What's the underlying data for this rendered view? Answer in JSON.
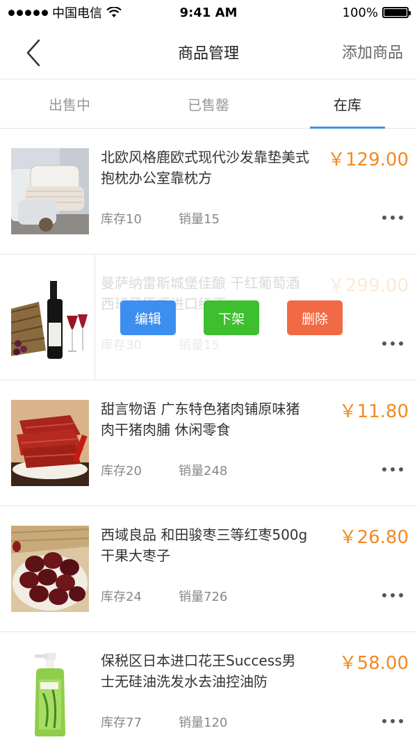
{
  "status_bar": {
    "carrier": "中国电信",
    "time": "9:41 AM",
    "battery": "100%"
  },
  "nav": {
    "title": "商品管理",
    "action": "添加商品",
    "back_icon": "chevron-left-icon"
  },
  "tabs": [
    {
      "label": "出售中",
      "active": false
    },
    {
      "label": "已售罄",
      "active": false
    },
    {
      "label": "在库",
      "active": true
    }
  ],
  "colors": {
    "accent": "#3f8fe6",
    "price": "#f08a24",
    "edit": "#3c8ff0",
    "offshelf": "#3dbf2f",
    "delete": "#f26a45"
  },
  "products": [
    {
      "title": "北欧风格鹿欧式现代沙发靠垫美式抱枕办公室靠枕方",
      "price": "￥129.00",
      "stock": "库存10",
      "sales": "销量15",
      "image": "pillows-image"
    },
    {
      "title": "曼萨纳雷斯城堡佳酿 干红葡萄酒 西班牙原瓶进口红酒",
      "price": "￥299.00",
      "stock": "库存30",
      "sales": "销量15",
      "image": "red-wine-image",
      "actions": {
        "edit": "编辑",
        "offshelf": "下架",
        "delete": "删除"
      }
    },
    {
      "title": "甜言物语 广东特色猪肉铺原味猪肉干猪肉脯 休闲零食",
      "price": "￥11.80",
      "stock": "库存20",
      "sales": "销量248",
      "image": "pork-jerky-image"
    },
    {
      "title": "西域良品 和田骏枣三等红枣500g干果大枣子",
      "price": "￥26.80",
      "stock": "库存24",
      "sales": "销量726",
      "image": "red-dates-image"
    },
    {
      "title": "保税区日本进口花王Success男士无硅油洗发水去油控油防",
      "price": "￥58.00",
      "stock": "库存77",
      "sales": "销量120",
      "image": "shampoo-bottle-image"
    }
  ]
}
